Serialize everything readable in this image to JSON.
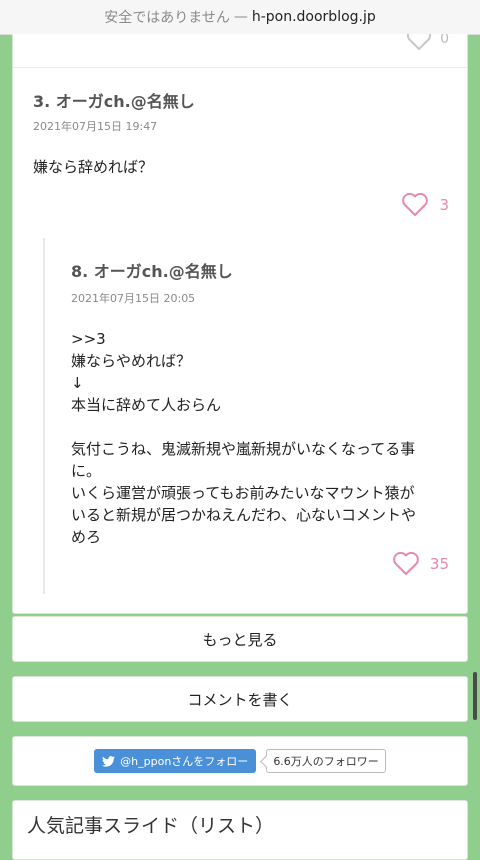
{
  "browser": {
    "insecure_label": "安全ではありません",
    "separator": "—",
    "domain": "h-pon.doorblog.jp"
  },
  "top_like": {
    "count": "0"
  },
  "comments": [
    {
      "header": "3. オーガch.@名無し",
      "date": "2021年07月15日 19:47",
      "body": "嫌なら辞めれば？",
      "likes": "3"
    },
    {
      "header": "8. オーガch.@名無し",
      "date": "2021年07月15日 20:05",
      "quote": ">>3",
      "body": "嫌ならやめれば？\n↓\n本当に辞めて人おらん\n\n気付こうね、鬼滅新規や嵐新規がいなくなってる事\nに。\nいくら運営が頑張ってもお前みたいなマウント猿が\nいると新規が居つかねえんだわ、心ないコメントや\nめろ",
      "likes": "35"
    }
  ],
  "buttons": {
    "more": "もっと見る",
    "write_comment": "コメントを書く"
  },
  "twitter": {
    "follow_label": "@h_pponさんをフォロー",
    "followers_label": "6.6万人のフォロワー"
  },
  "section": {
    "title": "人気記事スライド（リスト）"
  },
  "colors": {
    "page_bg": "#8fce8d",
    "like": "#e58aa8",
    "twitter": "#4a90d9"
  }
}
